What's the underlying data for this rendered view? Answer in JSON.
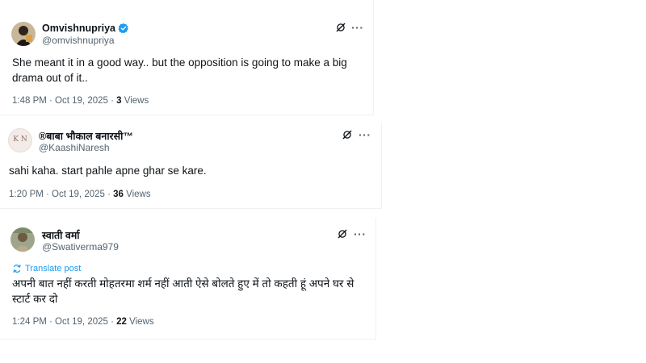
{
  "tweets": [
    {
      "display_name": "Omvishnupriya",
      "verified": true,
      "handle": "@omvishnupriya",
      "text": "She meant it in a good way.. but the opposition is going to make a big drama out of it..",
      "time": "1:48 PM · Oct 19, 2025 · ",
      "views_count": "3",
      "views_label": "Views"
    },
    {
      "display_name": "®बाबा भौकाल बनारसी™",
      "handle": "@KaashiNaresh",
      "avatar_text": "K N",
      "text": "sahi kaha. start pahle apne ghar se kare.",
      "time": "1:20 PM · Oct 19, 2025 · ",
      "views_count": "36",
      "views_label": "Views"
    },
    {
      "display_name": "स्वाती वर्मा",
      "handle": "@Swativerma979",
      "translate_label": "Translate post",
      "text": "अपनी बात नहीं करती मोहतरमा शर्म नहीं आती ऐसे बोलते हुए में तो कहती हूं अपने घर से स्टार्ट कर दो",
      "time": "1:24 PM · Oct 19, 2025 · ",
      "views_count": "22",
      "views_label": "Views"
    }
  ],
  "icons": [
    "verified-badge-icon",
    "grok-icon",
    "more-options-icon",
    "translate-icon"
  ],
  "colors": {
    "text": "#0f1419",
    "secondary": "#536471",
    "link": "#1d9bf0",
    "verified": "#1d9bf0"
  }
}
